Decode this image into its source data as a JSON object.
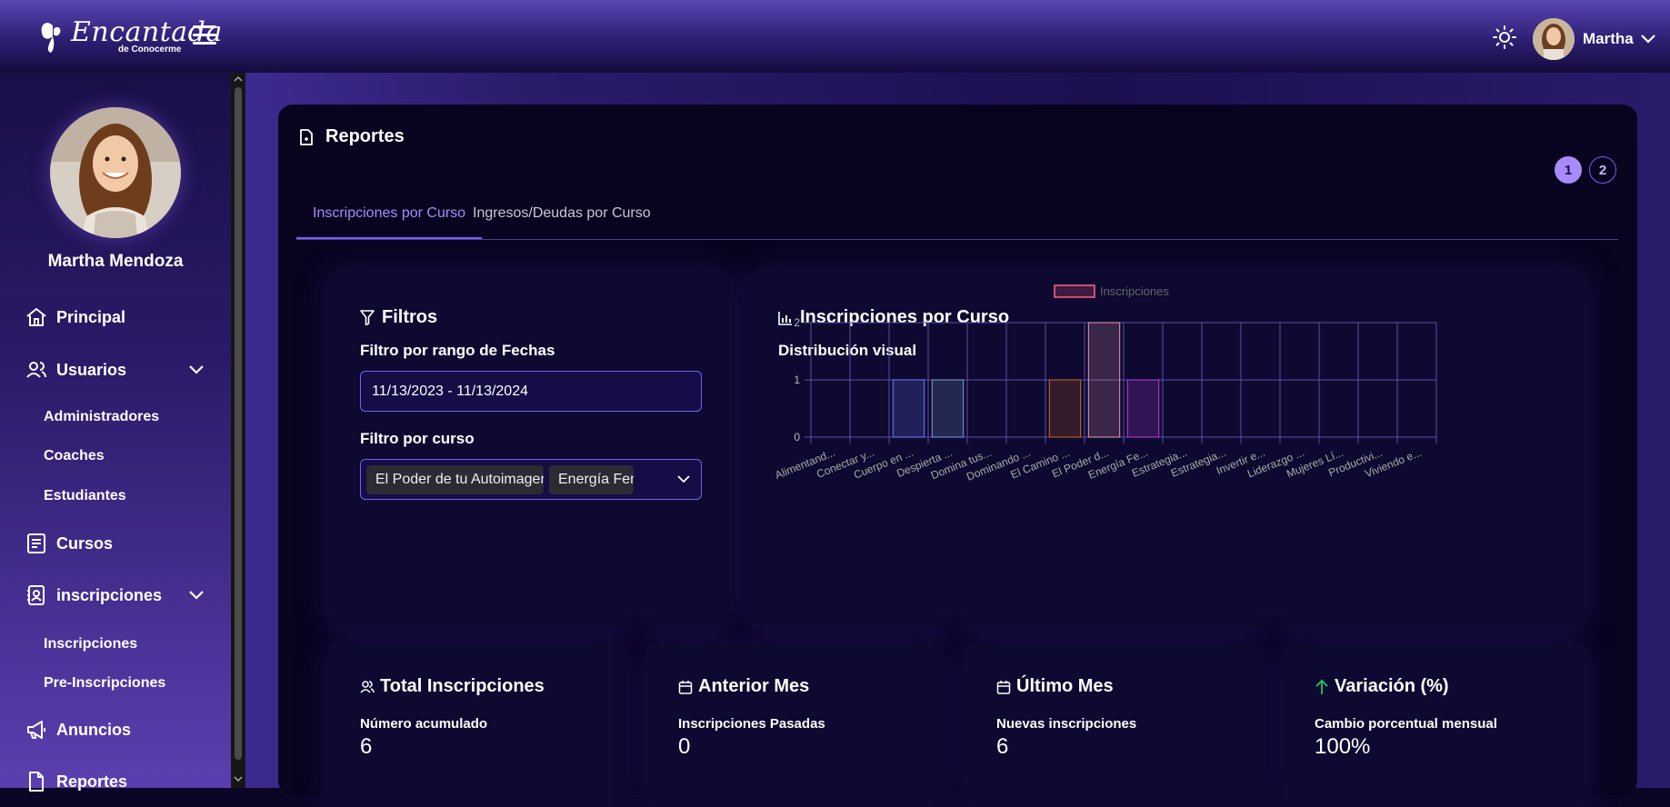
{
  "header": {
    "logo_text": "Encantada",
    "logo_subtext": "de Conocerme",
    "user_name": "Martha"
  },
  "sidebar": {
    "profile_name": "Martha Mendoza",
    "items": [
      {
        "label": "Principal",
        "icon": "home-icon"
      },
      {
        "label": "Usuarios",
        "icon": "users-icon",
        "children": [
          "Administradores",
          "Coaches",
          "Estudiantes"
        ]
      },
      {
        "label": "Cursos",
        "icon": "book-icon"
      },
      {
        "label": "inscripciones",
        "icon": "contact-book-icon",
        "children": [
          "Inscripciones",
          "Pre-Inscripciones"
        ]
      },
      {
        "label": "Anuncios",
        "icon": "megaphone-icon"
      },
      {
        "label": "Reportes",
        "icon": "report-icon"
      }
    ]
  },
  "page": {
    "title": "Reportes",
    "pagination": [
      "1",
      "2"
    ],
    "tabs": [
      "Inscripciones por Curso",
      "Ingresos/Deudas por Curso"
    ]
  },
  "filters": {
    "title": "Filtros",
    "date_label": "Filtro por rango de Fechas",
    "date_value": "11/13/2023 - 11/13/2024",
    "course_label": "Filtro por curso",
    "selected_courses": [
      "El Poder de tu Autoimagen",
      "Energía Femenina"
    ]
  },
  "chart_card": {
    "title": "Inscripciones por Curso",
    "subtitle": "Distribución visual"
  },
  "chart_data": {
    "type": "bar",
    "categories": [
      "Alimentand...",
      "Conectar y...",
      "Cuerpo en ...",
      "Despierta ...",
      "Domina tus...",
      "Dominando ...",
      "El Camino ...",
      "El Poder d...",
      "Energía Fe...",
      "Estrategia...",
      "Estrategia...",
      "Invertir e...",
      "Liderazgo ...",
      "Mujeres Lí...",
      "Productivi...",
      "Viviendo e..."
    ],
    "series": [
      {
        "name": "Inscripciones",
        "values": [
          0,
          0,
          1,
          1,
          0,
          0,
          1,
          2,
          1,
          0,
          0,
          0,
          0,
          0,
          0,
          0
        ]
      }
    ],
    "bar_colors": [
      "#ff6384",
      "#ff9f40",
      "#6e7fff",
      "#7aa3d6",
      "#4bc0c0",
      "#9966ff",
      "#d2691e",
      "#e8a0b0",
      "#c040e0",
      "#6060ff",
      "#60a0ff",
      "#40c0a0",
      "#c06040",
      "#a060c0",
      "#60c060",
      "#c0c040"
    ],
    "yticks": [
      "0",
      "1",
      "2"
    ],
    "ylim": [
      0,
      2
    ],
    "legend": "top",
    "grid": true
  },
  "stats": [
    {
      "title": "Total Inscripciones",
      "icon": "users-icon",
      "subtitle": "Número acumulado",
      "value": "6"
    },
    {
      "title": "Anterior Mes",
      "icon": "calendar-icon",
      "subtitle": "Inscripciones Pasadas",
      "value": "0"
    },
    {
      "title": "Último Mes",
      "icon": "calendar-icon",
      "subtitle": "Nuevas inscripciones",
      "value": "6"
    },
    {
      "title": "Variación (%)",
      "icon": "arrow-up-icon",
      "subtitle": "Cambio porcentual mensual",
      "value": "100%"
    }
  ]
}
